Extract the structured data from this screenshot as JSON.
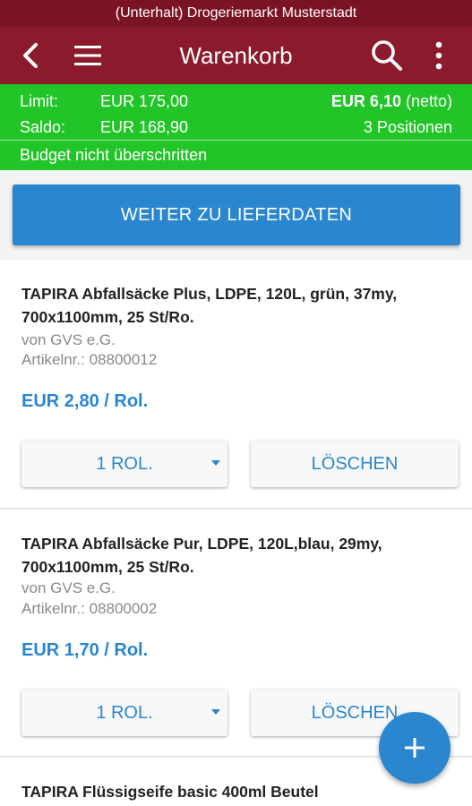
{
  "status_bar": {
    "text": "(Unterhalt) Drogeriemarkt Musterstadt"
  },
  "app_bar": {
    "title": "Warenkorb"
  },
  "budget": {
    "limit_label": "Limit:",
    "limit_value": "EUR 175,00",
    "total_value": "EUR 6,10",
    "total_suffix": " (netto)",
    "saldo_label": "Saldo:",
    "saldo_value": "EUR 168,90",
    "positions": "3 Positionen",
    "status": "Budget nicht überschritten"
  },
  "continue_button": {
    "label": "WEITER ZU LIEFERDATEN"
  },
  "items": [
    {
      "name_line1": "TAPIRA Abfallsäcke Plus, LDPE, 120L, grün, 37my,",
      "name_line2": "700x1100mm, 25 St/Ro.",
      "supplier": "von GVS e.G.",
      "article": "Artikelnr.: 08800012",
      "price": "EUR 2,80 / Rol.",
      "quantity": "1 ROL.",
      "delete_label": "LÖSCHEN"
    },
    {
      "name_line1": "TAPIRA Abfallsäcke Pur, LDPE, 120L,blau, 29my,",
      "name_line2": "700x1100mm, 25 St/Ro.",
      "supplier": "von GVS e.G.",
      "article": "Artikelnr.: 08800002",
      "price": "EUR 1,70 / Rol.",
      "quantity": "1 ROL.",
      "delete_label": "LÖSCHEN"
    },
    {
      "name_line1": "TAPIRA Flüssigseife basic 400ml Beutel"
    }
  ],
  "icons": [
    "back-arrow-icon",
    "menu-icon",
    "search-icon",
    "more-vert-icon",
    "caret-down-icon",
    "plus-icon"
  ],
  "colors": {
    "status_bar": "#7a1425",
    "app_bar": "#8b1a2d",
    "budget_ok": "#22c528",
    "accent": "#2a86cf"
  }
}
